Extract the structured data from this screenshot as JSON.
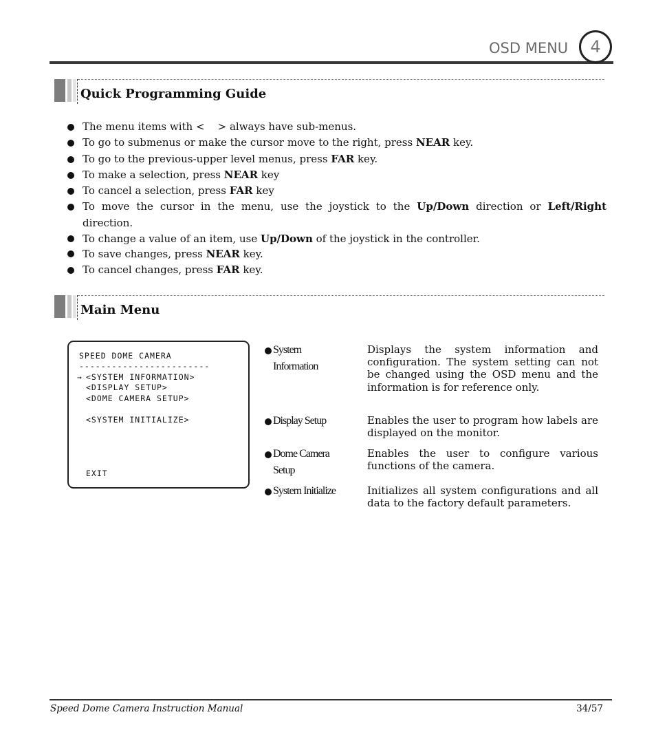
{
  "header": {
    "title": "OSD MENU",
    "chapter_number": "4"
  },
  "sections": {
    "quick_guide": {
      "title": "Quick Programming Guide",
      "bullets": [
        {
          "parts": [
            {
              "t": "The menu items with <    > always have sub-menus."
            }
          ]
        },
        {
          "parts": [
            {
              "t": "To go to submenus or make the cursor move to the right, press "
            },
            {
              "t": "NEAR",
              "b": true
            },
            {
              "t": " key."
            }
          ]
        },
        {
          "parts": [
            {
              "t": "To go to the previous-upper level menus, press "
            },
            {
              "t": "FAR",
              "b": true
            },
            {
              "t": " key."
            }
          ]
        },
        {
          "parts": [
            {
              "t": "To make a selection, press "
            },
            {
              "t": "NEAR",
              "b": true
            },
            {
              "t": " key"
            }
          ]
        },
        {
          "parts": [
            {
              "t": "To cancel a selection, press "
            },
            {
              "t": "FAR",
              "b": true
            },
            {
              "t": " key"
            }
          ]
        },
        {
          "parts": [
            {
              "t": "To move the cursor in the menu, use the joystick to the "
            },
            {
              "t": "Up/Down",
              "b": true
            },
            {
              "t": " direction or "
            },
            {
              "t": "Left/Right",
              "b": true
            },
            {
              "t": " direction."
            }
          ]
        },
        {
          "parts": [
            {
              "t": "To change a value of an item, use "
            },
            {
              "t": "Up/Down",
              "b": true
            },
            {
              "t": " of the joystick in the controller."
            }
          ],
          "tight": true
        },
        {
          "parts": [
            {
              "t": "To save changes, press "
            },
            {
              "t": "NEAR",
              "b": true
            },
            {
              "t": " key."
            }
          ],
          "tight": true
        },
        {
          "parts": [
            {
              "t": "To cancel changes, press "
            },
            {
              "t": "FAR",
              "b": true
            },
            {
              "t": " key."
            }
          ]
        }
      ]
    },
    "main_menu": {
      "title": "Main Menu",
      "osd_screen": {
        "title": "SPEED DOME CAMERA",
        "separator": "------------------------",
        "cursor_icon": "arrow-right",
        "items": [
          "<SYSTEM INFORMATION>",
          "<DISPLAY SETUP>",
          "<DOME CAMERA SETUP>",
          "<SYSTEM INITIALIZE>"
        ],
        "exit": "EXIT"
      },
      "descriptions": [
        {
          "label": "System Information",
          "text": "Displays the system information and configuration. The system setting can not be changed using the OSD menu and the information is for reference only."
        },
        {
          "label": "Display Setup",
          "text": "Enables the user to program how labels are displayed on the monitor."
        },
        {
          "label": "Dome Camera Setup",
          "text": "Enables the user to configure various functions of the camera."
        },
        {
          "label": "System Initialize",
          "text": "Initializes all system configurations and all data to the factory default parameters."
        }
      ]
    }
  },
  "footer": {
    "title": "Speed Dome Camera Instruction Manual",
    "page": "34/57"
  }
}
